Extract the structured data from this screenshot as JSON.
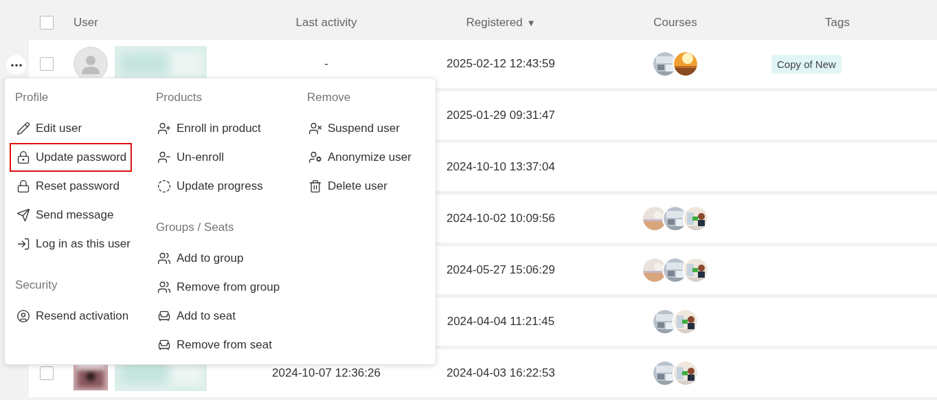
{
  "table": {
    "select_all": {
      "checked": false
    },
    "columns": [
      {
        "label": "User"
      },
      {
        "label": "Last activity"
      },
      {
        "label": "Registered",
        "sort_indicator": "▼"
      },
      {
        "label": "Courses"
      },
      {
        "label": "Tags"
      }
    ],
    "rows": [
      {
        "checked": false,
        "avatar": {
          "kind": "placeholder"
        },
        "name": {
          "kind": "picture"
        },
        "last_activity": "-",
        "registered": "2025-02-12 12:43:59",
        "courses": [
          {
            "kind": "picture"
          },
          {
            "kind": "picture"
          }
        ],
        "tags": [
          "Copy of New"
        ]
      },
      {
        "registered": "2025-01-29 09:31:47",
        "courses": [],
        "tags": []
      },
      {
        "registered": "2024-10-10 13:37:04",
        "courses": [],
        "tags": []
      },
      {
        "registered": "2024-10-02 10:09:56",
        "courses": [
          {
            "kind": "picture"
          },
          {
            "kind": "picture"
          },
          {
            "kind": "picture"
          }
        ],
        "tags": []
      },
      {
        "registered": "2024-05-27 15:06:29",
        "courses": [
          {
            "kind": "picture"
          },
          {
            "kind": "picture"
          },
          {
            "kind": "picture"
          }
        ],
        "tags": []
      },
      {
        "registered": "2024-04-04 11:21:45",
        "courses": [
          {
            "kind": "picture"
          },
          {
            "kind": "picture"
          }
        ],
        "tags": []
      },
      {
        "checked": false,
        "avatar": {
          "kind": "picture"
        },
        "name": {
          "kind": "picture"
        },
        "last_activity": "2024-10-07 12:36:26",
        "registered": "2024-04-03 16:22:53",
        "courses": [
          {
            "kind": "picture"
          },
          {
            "kind": "picture"
          }
        ],
        "tags": []
      }
    ]
  },
  "row_menu": {
    "columns": [
      {
        "sections": [
          {
            "title": "Profile",
            "items": [
              {
                "label": "Edit user",
                "highlighted": false
              },
              {
                "label": "Update password",
                "highlighted": true
              },
              {
                "label": "Reset password",
                "highlighted": false
              },
              {
                "label": "Send message",
                "highlighted": false
              },
              {
                "label": "Log in as this user",
                "highlighted": false
              }
            ]
          },
          {
            "title": "Security",
            "items": [
              {
                "label": "Resend activation",
                "highlighted": false
              }
            ]
          }
        ]
      },
      {
        "sections": [
          {
            "title": "Products",
            "items": [
              {
                "label": "Enroll in product",
                "highlighted": false
              },
              {
                "label": "Un-enroll",
                "highlighted": false
              },
              {
                "label": "Update progress",
                "highlighted": false
              }
            ]
          },
          {
            "title": "Groups / Seats",
            "items": [
              {
                "label": "Add to group",
                "highlighted": false
              },
              {
                "label": "Remove from group",
                "highlighted": false
              },
              {
                "label": "Add to seat",
                "highlighted": false
              },
              {
                "label": "Remove from seat",
                "highlighted": false
              }
            ]
          }
        ]
      },
      {
        "sections": [
          {
            "title": "Remove",
            "items": [
              {
                "label": "Suspend user",
                "highlighted": false
              },
              {
                "label": "Anonymize user",
                "highlighted": false
              },
              {
                "label": "Delete user",
                "highlighted": false
              }
            ]
          }
        ]
      }
    ]
  }
}
